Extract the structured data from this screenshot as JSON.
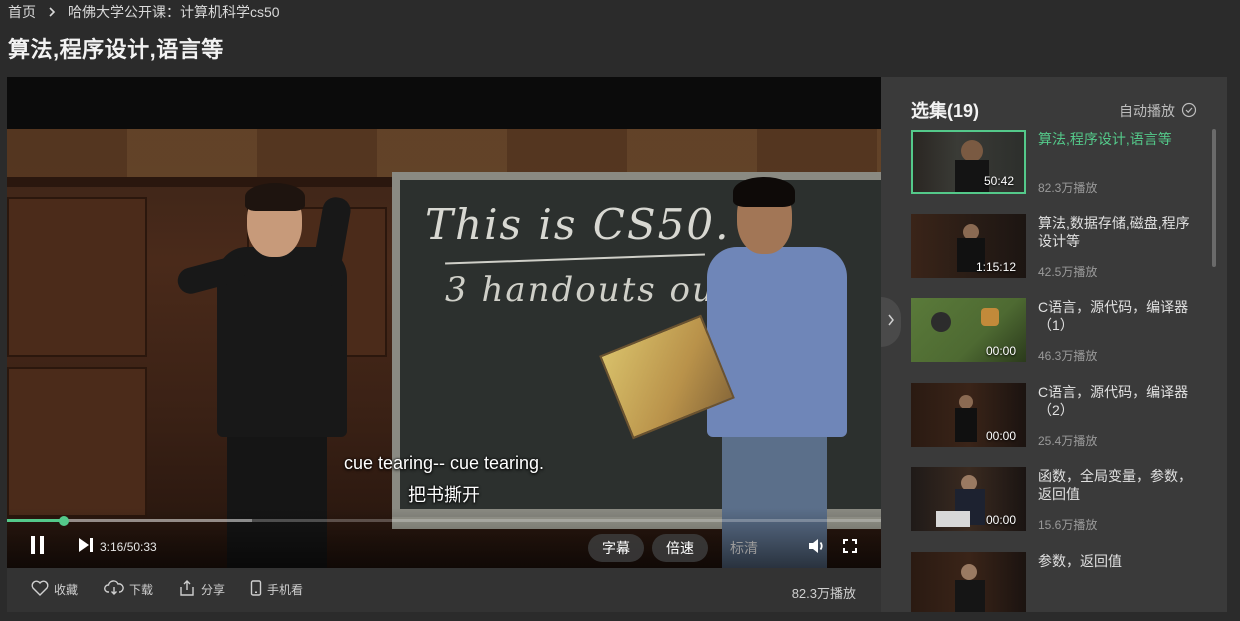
{
  "breadcrumb": {
    "home": "首页",
    "course": "哈佛大学公开课：计算机科学cs50"
  },
  "page_title": "算法,程序设计,语言等",
  "video": {
    "subtitle_en": "cue tearing-- cue tearing.",
    "subtitle_zh": "把书撕开",
    "board_line1": "This is CS50.",
    "board_line2": "3 handouts outs..",
    "current_time": "3:16",
    "duration": "50:33",
    "time_display": "3:16/50:33",
    "progress_fraction": 0.065,
    "buffered_fraction": 0.28,
    "buttons": {
      "subtitles": "字幕",
      "speed": "倍速",
      "quality": "标清"
    }
  },
  "actions": {
    "favorite": "收藏",
    "download": "下载",
    "share": "分享",
    "mobile": "手机看",
    "play_count": "82.3万播放"
  },
  "playlist": {
    "title": "选集(19)",
    "autoplay_label": "自动播放",
    "episodes": [
      {
        "title": "算法,程序设计,语言等",
        "duration": "50:42",
        "views": "82.3万播放",
        "active": true
      },
      {
        "title": "算法,数据存储,磁盘,程序设计等",
        "duration": "1:15:12",
        "views": "42.5万播放",
        "active": false
      },
      {
        "title": "C语言，源代码，编译器（1）",
        "duration": "00:00",
        "views": "46.3万播放",
        "active": false
      },
      {
        "title": "C语言，源代码，编译器（2）",
        "duration": "00:00",
        "views": "25.4万播放",
        "active": false
      },
      {
        "title": "函数，全局变量，参数，返回值",
        "duration": "00:00",
        "views": "15.6万播放",
        "active": false
      },
      {
        "title": "参数，返回值",
        "duration": "",
        "views": "",
        "active": false
      }
    ]
  },
  "colors": {
    "accent": "#54c98a",
    "background": "#2b2b2b",
    "sidebar": "#3a3a3a"
  }
}
